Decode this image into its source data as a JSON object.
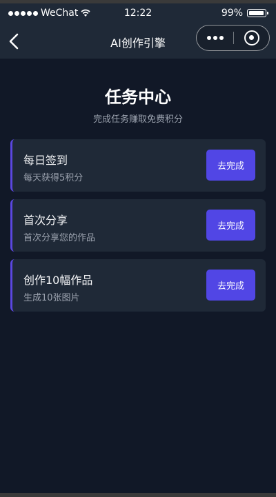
{
  "status_bar": {
    "carrier": "WeChat",
    "time": "12:22",
    "battery": "99%"
  },
  "nav": {
    "title": "AI创作引擎",
    "icons": [
      "back-arrow-icon",
      "more-dots-icon",
      "close-target-icon"
    ]
  },
  "header": {
    "title": "任务中心",
    "subtitle": "完成任务赚取免费积分"
  },
  "tasks": [
    {
      "name": "每日签到",
      "desc": "每天获得5积分",
      "button": "去完成"
    },
    {
      "name": "首次分享",
      "desc": "首次分享您的作品",
      "button": "去完成"
    },
    {
      "name": "创作10幅作品",
      "desc": "生成10张图片",
      "button": "去完成"
    }
  ],
  "colors": {
    "background": "#111827",
    "card": "#1f2937",
    "accent": "#5146e5",
    "text_secondary": "#9ca3af"
  }
}
